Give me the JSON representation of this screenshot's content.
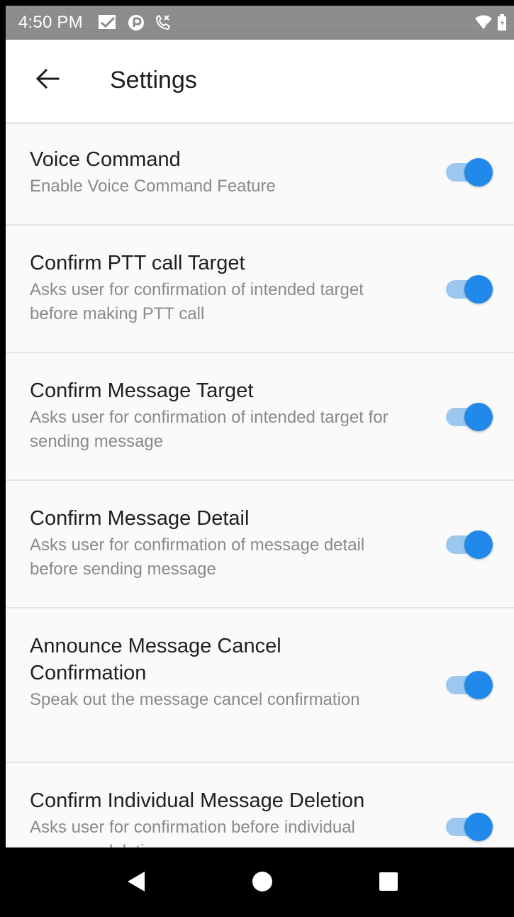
{
  "status_bar": {
    "time": "4:50 PM",
    "icons_left": [
      "message-icon",
      "location-icon",
      "missed-call-icon"
    ],
    "icons_right": [
      "wifi-icon",
      "battery-icon"
    ]
  },
  "app_bar": {
    "title": "Settings",
    "back_icon": "arrow-back-icon"
  },
  "settings": [
    {
      "title": "Voice Command",
      "description": "Enable Voice Command Feature",
      "enabled": true
    },
    {
      "title": "Confirm PTT call Target",
      "description": "Asks user for confirmation of intended target before making PTT call",
      "enabled": true
    },
    {
      "title": "Confirm Message Target",
      "description": "Asks user for confirmation of intended target for sending message",
      "enabled": true
    },
    {
      "title": "Confirm Message Detail",
      "description": "Asks user for confirmation of message detail before sending message",
      "enabled": true
    },
    {
      "title": "Announce Message Cancel Confirmation",
      "description": "Speak out the message cancel confirmation",
      "enabled": true
    },
    {
      "title": "Confirm Individual Message Deletion",
      "description": "Asks user for confirmation before individual message deletion",
      "enabled": true
    }
  ],
  "nav_bar": {
    "buttons": [
      "back-triangle-icon",
      "home-circle-icon",
      "recents-square-icon"
    ]
  },
  "colors": {
    "accent": "#2189ea",
    "track": "#9cc8f0",
    "status_bar": "#8a8a8a"
  }
}
